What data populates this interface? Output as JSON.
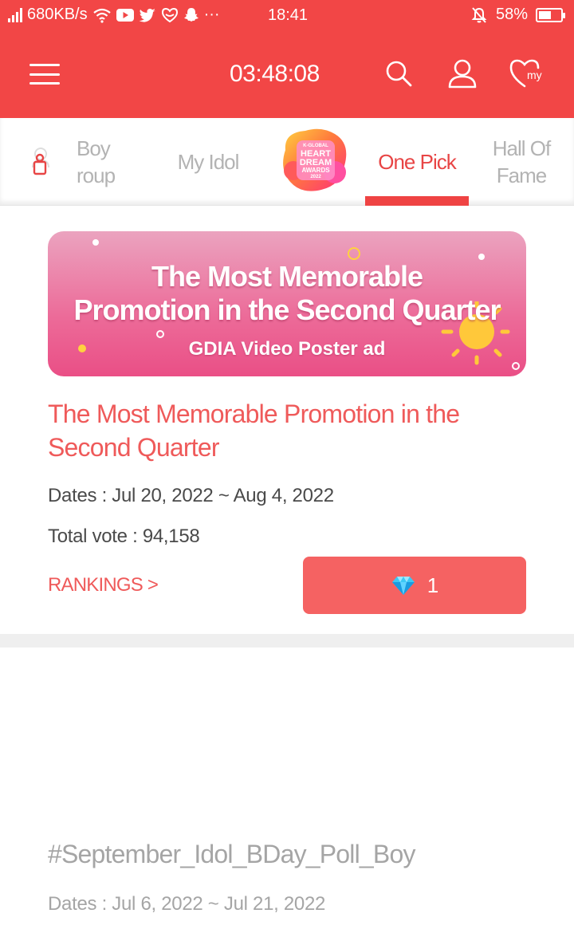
{
  "status_bar": {
    "network_speed": "680KB/s",
    "time": "18:41",
    "battery_percent": "58%",
    "battery_level": 0.58,
    "more_dots": "···"
  },
  "app_bar": {
    "timer": "03:48:08",
    "icons": [
      "menu-icon",
      "search-icon",
      "profile-icon",
      "my-heart-icon"
    ],
    "my_label": "my"
  },
  "tabs": [
    {
      "label": "Boy\nGroup",
      "display": "Boy\nroup",
      "active": false
    },
    {
      "label": "My Idol",
      "active": false
    },
    {
      "label": "One Pick",
      "active": true
    },
    {
      "label": "Hall Of\nFame",
      "active": false
    }
  ],
  "hda_logo": {
    "line1": "K-GLOBAL",
    "line2": "HEART",
    "line3": "DREAM",
    "line4": "AWARDS",
    "line5": "2022"
  },
  "vote_card": {
    "banner_line1": "The Most Memorable",
    "banner_line2": "Promotion in the Second Quarter",
    "banner_sub": "GDIA Video Poster ad",
    "title": "The Most Memorable Promotion in the Second Quarter",
    "dates": "Dates : Jul 20, 2022 ~ Aug 4, 2022",
    "total_vote": "Total vote : 94,158",
    "rankings_link": "RANKINGS >",
    "vote_cost": "1"
  },
  "second_card": {
    "title": "#September_Idol_BDay_Poll_Boy",
    "dates": "Dates : Jul 6, 2022 ~ Jul 21, 2022"
  },
  "colors": {
    "brand_red": "#f24646",
    "title_red": "#ef5a5a",
    "vote_button": "#f56262",
    "inactive_tab": "#b3b3b3"
  }
}
